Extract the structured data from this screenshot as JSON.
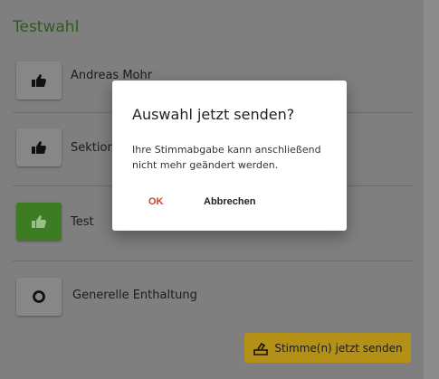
{
  "section": {
    "title": "Testwahl"
  },
  "options": [
    {
      "label": "Andreas Mohr",
      "icon": "thumbs-up-icon",
      "selected": false
    },
    {
      "label": "Sektion",
      "icon": "thumbs-up-icon",
      "selected": false
    },
    {
      "label": "Test",
      "icon": "thumbs-up-icon",
      "selected": true
    },
    {
      "label": "Generelle Enthaltung",
      "icon": "circle-icon",
      "selected": false
    }
  ],
  "submit": {
    "label": "Stimme(n) jetzt senden",
    "icon": "ballot-box-icon"
  },
  "dialog": {
    "title": "Auswahl jetzt senden?",
    "message": "Ihre Stimmabgabe kann anschließend nicht mehr geändert werden.",
    "ok_label": "OK",
    "cancel_label": "Abbrechen"
  },
  "colors": {
    "accent_green": "#3d7c22",
    "submit_yellow": "#b59016",
    "ok_red": "#d0402a"
  }
}
